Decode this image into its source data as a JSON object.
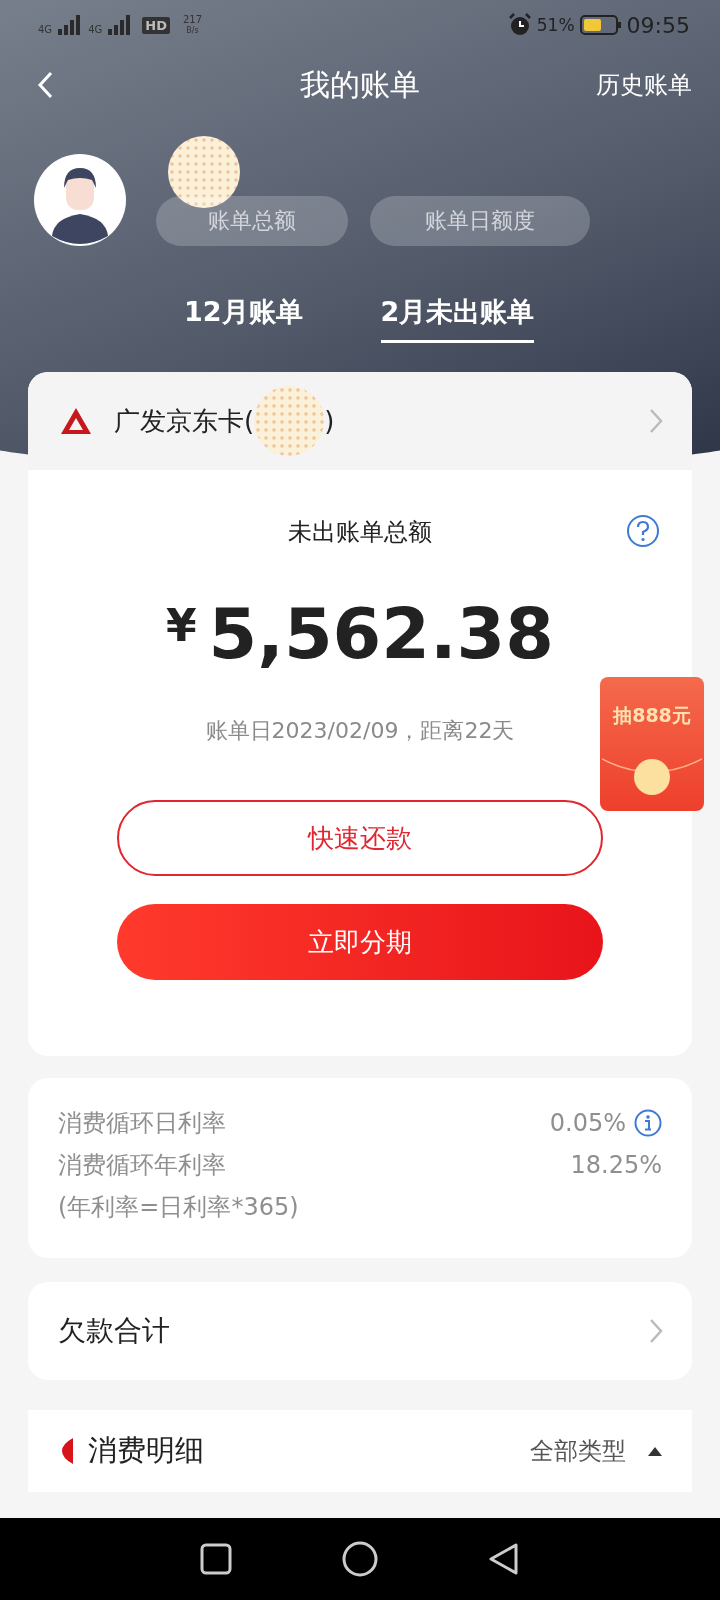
{
  "status_bar": {
    "networks": [
      {
        "label": "4G"
      },
      {
        "label": "4G"
      }
    ],
    "hd": "HD",
    "speed": "217",
    "speed_unit": "B/s",
    "battery": "51%",
    "time": "09:55"
  },
  "nav": {
    "title": "我的账单",
    "action": "历史账单"
  },
  "profile": {
    "chips": [
      "账单总额",
      "账单日额度"
    ]
  },
  "tabs": [
    {
      "label": "12月账单",
      "selected": false
    },
    {
      "label": "2月未出账单",
      "selected": true
    }
  ],
  "card": {
    "name_start": "广发京东卡(",
    "name_end": ")",
    "summary_label": "未出账单总额",
    "currency": "¥",
    "amount": "5,562.38",
    "due_note": "账单日2023/02/09，距离22天",
    "buttons": [
      {
        "label": "快速还款",
        "kind": "outline"
      },
      {
        "label": "立即分期",
        "kind": "filled"
      }
    ]
  },
  "promo": {
    "label": "抽888元"
  },
  "rates": {
    "rows": [
      {
        "label": "消费循环日利率",
        "value": "0.05%",
        "info": true
      },
      {
        "label": "消费循环年利率",
        "value": "18.25%",
        "info": false
      }
    ],
    "note": "(年利率=日利率*365)"
  },
  "debt": {
    "label": "欠款合计"
  },
  "details": {
    "title": "消费明细",
    "filter": "全部类型"
  }
}
